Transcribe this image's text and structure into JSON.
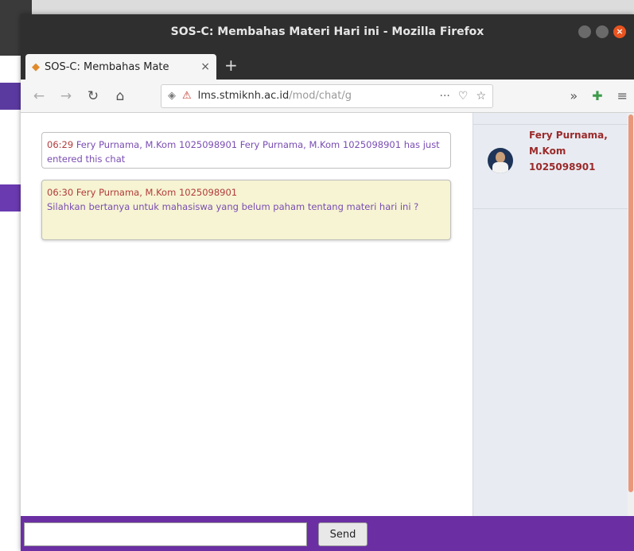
{
  "window": {
    "title": "SOS-C: Membahas Materi Hari ini - Mozilla Firefox",
    "close_symbol": "×"
  },
  "tab": {
    "label": "SOS-C: Membahas Mate",
    "close": "×",
    "new_tab": "+"
  },
  "urlbar": {
    "domain": "lms.stmiknh.ac.id",
    "path": "/mod/chat/g",
    "more": "···"
  },
  "nav_icons": {
    "back": "←",
    "forward": "→",
    "reload": "↻",
    "home": "⌂",
    "overflow": "»",
    "menu": "≡"
  },
  "messages": [
    {
      "time": "06:29",
      "text": "Fery Purnama, M.Kom 1025098901 Fery Purnama, M.Kom 1025098901 has just entered this chat"
    },
    {
      "time": "06:30",
      "author": "Fery Purnama, M.Kom 1025098901",
      "text": "Silahkan bertanya untuk mahasiswa yang belum paham tentang materi hari ini ?"
    }
  ],
  "sidebar": {
    "users": [
      {
        "name": "Fery Purnama, M.Kom 1025098901"
      }
    ]
  },
  "input": {
    "value": "",
    "send_label": "Send"
  },
  "colors": {
    "input_bar": "#6b2fa3",
    "user_name": "#9b2a2a",
    "message_bg": "#f6f4d2",
    "scroll_thumb": "#e9977a"
  }
}
